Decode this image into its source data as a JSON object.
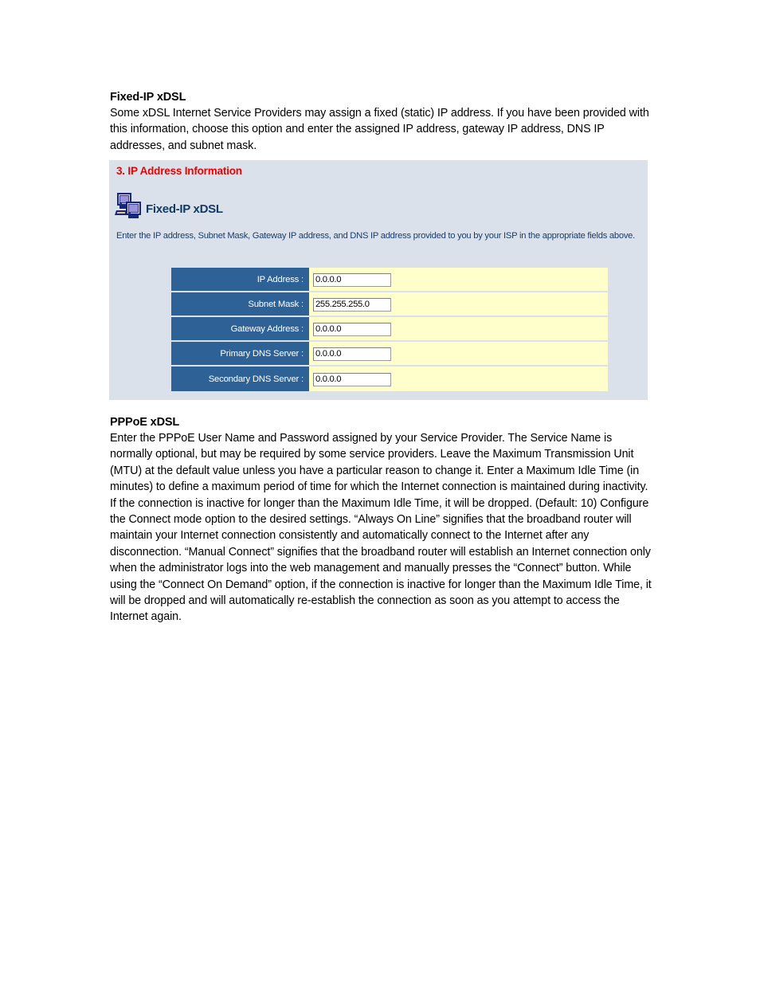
{
  "document": {
    "sections": [
      {
        "heading": "Fixed-IP xDSL",
        "body": "Some xDSL Internet Service Providers may assign a fixed (static) IP address. If you have been provided with this information, choose this option and enter the assigned IP address, gateway IP address, DNS IP addresses, and subnet mask."
      },
      {
        "heading": "PPPoE xDSL",
        "body": "Enter the PPPoE User Name and Password assigned by your Service Provider. The Service Name is normally optional, but may be required by some service providers. Leave the Maximum Transmission Unit (MTU) at the default value unless you have a particular reason to change it. Enter a Maximum Idle Time (in minutes) to define a maximum period of time for which the Internet connection is maintained during inactivity. If the connection is inactive for longer than the Maximum Idle Time, it will be dropped. (Default: 10) Configure the Connect mode option to the desired settings. “Always On Line” signifies that the broadband router will maintain your Internet connection consistently and automatically connect to the Internet after any disconnection. “Manual Connect” signifies that the broadband router will establish an Internet connection only when the administrator logs into the web management and manually presses the “Connect” button. While using the “Connect On Demand” option, if the connection is inactive for longer than the Maximum Idle Time, it will be dropped and will automatically re-establish the connection as soon as you attempt to access the Internet again."
      }
    ]
  },
  "screenshot": {
    "step_title": "3. IP Address Information",
    "section_icon": "computer-network-icon",
    "section_label": "Fixed-IP xDSL",
    "description": "Enter the IP address, Subnet Mask, Gateway IP address, and DNS IP address provided to you by your ISP in the appropriate fields above.",
    "fields": [
      {
        "label": "IP Address :",
        "value": "0.0.0.0"
      },
      {
        "label": "Subnet Mask :",
        "value": "255.255.255.0"
      },
      {
        "label": "Gateway Address :",
        "value": "0.0.0.0"
      },
      {
        "label": "Primary DNS Server :",
        "value": "0.0.0.0"
      },
      {
        "label": "Secondary DNS Server :",
        "value": "0.0.0.0"
      }
    ],
    "colors": {
      "panel_background": "#dbe1ea",
      "title_red": "#ee0000",
      "label_blue": "#2e6195",
      "field_yellow": "#ffffcc",
      "heading_navy": "#123a63"
    }
  }
}
